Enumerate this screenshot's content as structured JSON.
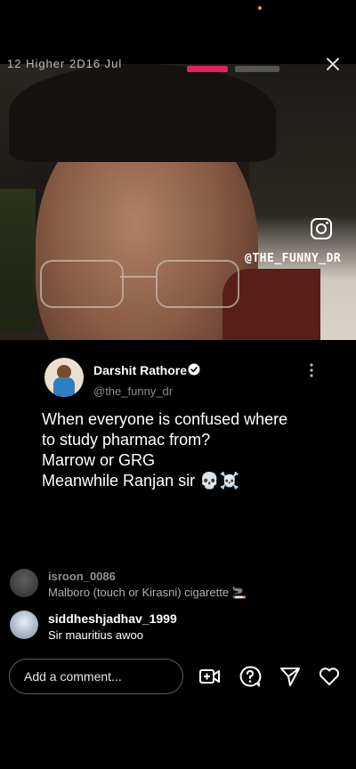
{
  "story": {
    "top_text": "12 Higher 2D16 Jul"
  },
  "watermark": {
    "handle": "@THE_FUNNY_DR",
    "icon": "instagram-icon"
  },
  "tweet": {
    "name": "Darshit Rathore",
    "handle": "@the_funny_dr",
    "lines": [
      "When everyone is confused where",
      "to study pharmac from?",
      "Marrow or GRG",
      "Meanwhile Ranjan sir 💀☠️"
    ]
  },
  "comments": [
    {
      "user": "isroon_0086",
      "text": "Malboro (touch or Kirasni) cigarette 🚬"
    },
    {
      "user": "siddheshjadhav_1999",
      "text": "Sir mauritius awoo"
    }
  ],
  "comment_box": {
    "placeholder": "Add a comment..."
  },
  "colors": {
    "accent": "#e0245e",
    "background": "#000000"
  }
}
